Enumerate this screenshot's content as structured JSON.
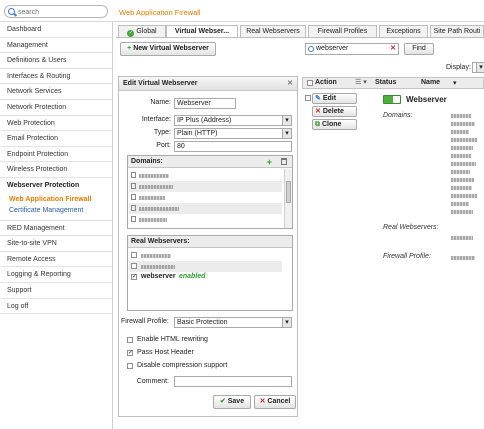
{
  "topbar": {
    "search_placeholder": "search",
    "app_title": "Web Application Firewall"
  },
  "sidebar": {
    "items_before": [
      "Dashboard",
      "Management",
      "Definitions & Users",
      "Interfaces & Routing",
      "Network Services",
      "Network Protection",
      "Web Protection",
      "Email Protection",
      "Endpoint Protection",
      "Wireless Protection"
    ],
    "group": "Webserver Protection",
    "subitems": [
      {
        "label": "Web Application Firewall",
        "active": true
      },
      {
        "label": "Certificate Management",
        "active": false
      }
    ],
    "items_after": [
      "RED Management",
      "Site-to-site VPN",
      "Remote Access",
      "Logging & Reporting",
      "Support",
      "Log off"
    ]
  },
  "tabs": [
    "Global",
    "Virtual Webser...",
    "Real Webservers",
    "Firewall Profiles",
    "Exceptions",
    "Site Path Routi"
  ],
  "toolbar": {
    "new_button": "New Virtual Webserver",
    "filter_value": "webserver",
    "find_button": "Find",
    "display_label": "Display:"
  },
  "edit_panel": {
    "title": "Edit Virtual Webserver",
    "name_label": "Name:",
    "name_value": "Webserver",
    "interface_label": "Interface:",
    "interface_value": "IP Plus (Address)",
    "type_label": "Type:",
    "type_value": "Plain (HTTP)",
    "port_label": "Port:",
    "port_value": "80",
    "domains_header": "Domains:",
    "realservers_header": "Real Webservers:",
    "realserver_name": "webserver",
    "realserver_status": "enabled",
    "profile_label": "Firewall Profile:",
    "profile_value": "Basic Protection",
    "options": [
      {
        "label": "Enable HTML rewriting",
        "checked": false
      },
      {
        "label": "Pass Host Header",
        "checked": true
      },
      {
        "label": "Disable compression support",
        "checked": false
      }
    ],
    "comment_label": "Comment:",
    "save_button": "Save",
    "cancel_button": "Cancel"
  },
  "list": {
    "col_action": "Action",
    "col_status": "Status",
    "col_name": "Name",
    "edit_button": "Edit",
    "delete_button": "Delete",
    "clone_button": "Clone",
    "entry_name": "Webserver",
    "domains_label": "Domains:",
    "real_label": "Real Webservers:",
    "profile_label": "Firewall Profile:"
  },
  "colors": {
    "accent": "#e67e00",
    "link": "#2a5db0",
    "toggle_on": "#4caf3a"
  }
}
